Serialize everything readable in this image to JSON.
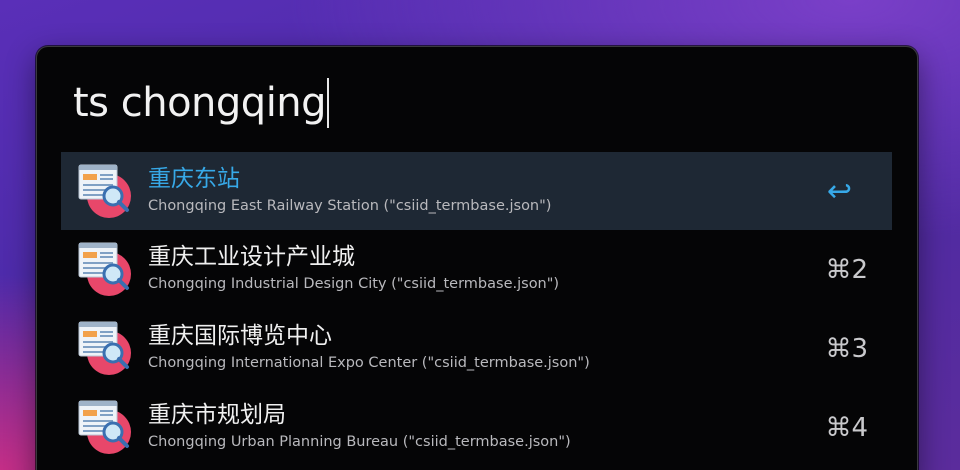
{
  "search": {
    "query": "ts chongqing"
  },
  "results": [
    {
      "title": "重庆东站",
      "subtitle": "Chongqing East Railway Station (\"csiid_termbase.json\")",
      "shortcut": "↩",
      "icon": "dictionary-search-icon",
      "selected": true
    },
    {
      "title": "重庆工业设计产业城",
      "subtitle": "Chongqing Industrial Design City (\"csiid_termbase.json\")",
      "shortcut": "⌘2",
      "icon": "dictionary-search-icon",
      "selected": false
    },
    {
      "title": "重庆国际博览中心",
      "subtitle": "Chongqing International Expo Center (\"csiid_termbase.json\")",
      "shortcut": "⌘3",
      "icon": "dictionary-search-icon",
      "selected": false
    },
    {
      "title": "重庆市规划局",
      "subtitle": "Chongqing Urban Planning Bureau (\"csiid_termbase.json\")",
      "shortcut": "⌘4",
      "icon": "dictionary-search-icon",
      "selected": false
    }
  ],
  "colors": {
    "selected_title": "#37a9e8",
    "selected_row_bg": "#1e2834",
    "window_bg": "#050506"
  }
}
